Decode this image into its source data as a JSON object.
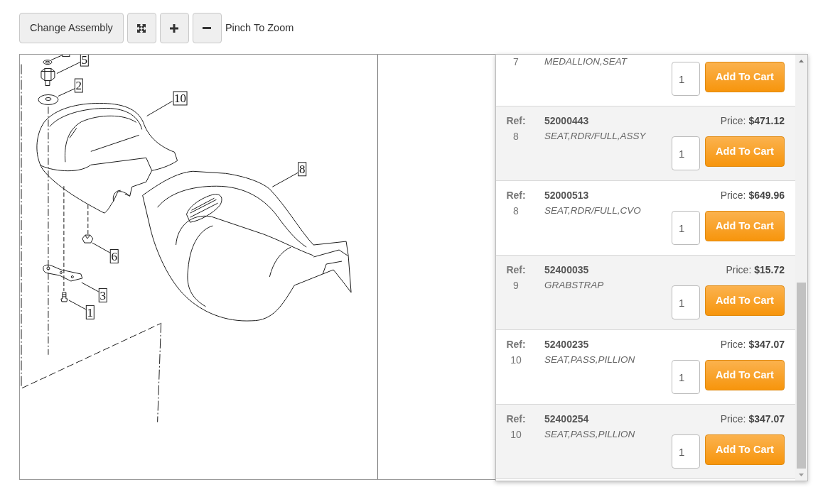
{
  "toolbar": {
    "buttons": [
      {
        "kind": "text",
        "label": "Change Assembly"
      },
      {
        "kind": "fit"
      },
      {
        "kind": "zoom_in"
      },
      {
        "kind": "zoom_out"
      }
    ],
    "hint": "Pinch To Zoom"
  },
  "diagram": {
    "callouts": [
      {
        "label": "5"
      },
      {
        "label": "2"
      },
      {
        "label": "10"
      },
      {
        "label": "8"
      },
      {
        "label": "6"
      },
      {
        "label": "3"
      },
      {
        "label": "1"
      }
    ]
  },
  "parts": [
    {
      "ref": "7",
      "description": "MEDALLION,SEAT",
      "quantity": "1",
      "button": "Add To Cart"
    },
    {
      "ref_label": "Ref:",
      "ref": "8",
      "part_number": "52000443",
      "price": "Price: **$471.12**",
      "description": "SEAT,RDR/FULL,ASSY",
      "quantity": "1",
      "button": "Add To Cart"
    },
    {
      "ref_label": "Ref:",
      "ref": "8",
      "part_number": "52000513",
      "price": "Price: **$649.96**",
      "description": "SEAT,RDR/FULL,CVO",
      "quantity": "1",
      "button": "Add To Cart"
    },
    {
      "ref_label": "Ref:",
      "ref": "9",
      "part_number": "52400035",
      "price": "Price: **$15.72**",
      "description": "GRABSTRAP",
      "quantity": "1",
      "button": "Add To Cart"
    },
    {
      "ref_label": "Ref:",
      "ref": "10",
      "part_number": "52400235",
      "price": "Price: **$347.07**",
      "description": "SEAT,PASS,PILLION",
      "quantity": "1",
      "button": "Add To Cart"
    },
    {
      "ref_label": "Ref:",
      "ref": "10",
      "part_number": "52400254",
      "price": "Price: **$347.07**",
      "description": "SEAT,PASS,PILLION",
      "quantity": "1",
      "button": "Add To Cart"
    }
  ]
}
